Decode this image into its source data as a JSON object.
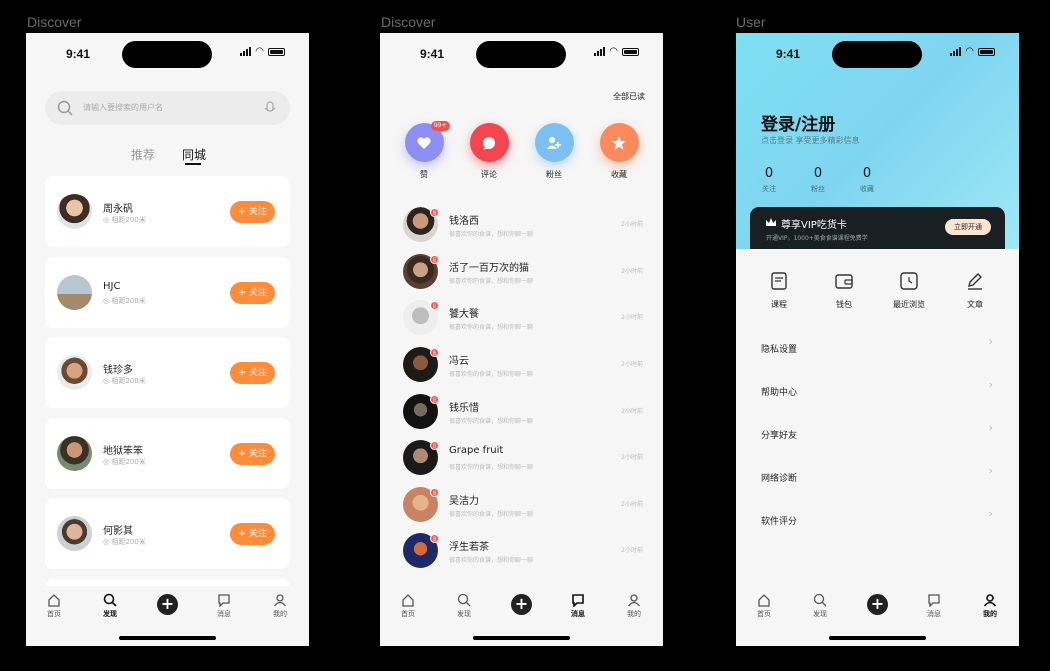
{
  "frames": [
    {
      "label": "Discover"
    },
    {
      "label": "Discover"
    },
    {
      "label": "User"
    }
  ],
  "status_time": "9:41",
  "discover": {
    "search_placeholder": "请输入要搜索的用户名",
    "tabs": [
      "推荐",
      "同城"
    ],
    "active_tab": 1,
    "follow_label": "+ 关注",
    "users": [
      {
        "name": "周永矾",
        "distance": "相距200米"
      },
      {
        "name": "HJC",
        "distance": "相距200米"
      },
      {
        "name": "钱珍多",
        "distance": "相距200米"
      },
      {
        "name": "地狱笨笨",
        "distance": "相距200米"
      },
      {
        "name": "何影其",
        "distance": "相距200米"
      }
    ]
  },
  "messages": {
    "read_all": "全部已读",
    "categories": [
      {
        "label": "赞",
        "color": "#8e8ff5",
        "icon": "heart-icon",
        "badge": "99+"
      },
      {
        "label": "评论",
        "color": "#f5454f",
        "icon": "comment-icon"
      },
      {
        "label": "粉丝",
        "color": "#7cc0f2",
        "icon": "fans-icon"
      },
      {
        "label": "收藏",
        "color": "#fd8a5c",
        "icon": "star-icon"
      }
    ],
    "items": [
      {
        "name": "钱洛西",
        "text": "很喜欢你的食谱，想和你聊一聊",
        "time": "2小时前",
        "badge": "8"
      },
      {
        "name": "活了一百万次的猫",
        "text": "很喜欢你的食谱，想和你聊一聊",
        "time": "2小时前",
        "badge": "8"
      },
      {
        "name": "饕大餮",
        "text": "很喜欢你的食谱，想和你聊一聊",
        "time": "2小时前",
        "badge": "8"
      },
      {
        "name": "冯云",
        "text": "很喜欢你的食谱，想和你聊一聊",
        "time": "2小时前",
        "badge": "8"
      },
      {
        "name": "钱乐惜",
        "text": "很喜欢你的食谱，想和你聊一聊",
        "time": "2小时前",
        "badge": "8"
      },
      {
        "name": "Grape fruit",
        "text": "很喜欢你的食谱，想和你聊一聊",
        "time": "2小时前",
        "badge": "8"
      },
      {
        "name": "吴洁力",
        "text": "很喜欢你的食谱，想和你聊一聊",
        "time": "2小时前",
        "badge": "8"
      },
      {
        "name": "浮生若茶",
        "text": "很喜欢你的食谱，想和你聊一聊",
        "time": "2小时前",
        "badge": "8"
      }
    ]
  },
  "user": {
    "title": "登录/注册",
    "subtitle": "点击登录 享受更多精彩信息",
    "stats": [
      {
        "value": "0",
        "label": "关注"
      },
      {
        "value": "0",
        "label": "粉丝"
      },
      {
        "value": "0",
        "label": "收藏"
      }
    ],
    "vip_title": "尊享VIP吃货卡",
    "vip_sub": "开通VIP，1000+美食食谱课程免费学",
    "vip_button": "立即开通",
    "quick": [
      {
        "label": "课程",
        "icon": "course-icon"
      },
      {
        "label": "钱包",
        "icon": "wallet-icon"
      },
      {
        "label": "最近浏览",
        "icon": "history-icon"
      },
      {
        "label": "文章",
        "icon": "article-icon"
      }
    ],
    "settings": [
      {
        "label": "隐私设置"
      },
      {
        "label": "帮助中心"
      },
      {
        "label": "分享好友"
      },
      {
        "label": "网络诊断"
      },
      {
        "label": "软件评分"
      }
    ]
  },
  "tabbar": {
    "items": [
      {
        "label": "首页"
      },
      {
        "label": "发现"
      },
      {
        "label": ""
      },
      {
        "label": "消息"
      },
      {
        "label": "我的"
      }
    ]
  }
}
